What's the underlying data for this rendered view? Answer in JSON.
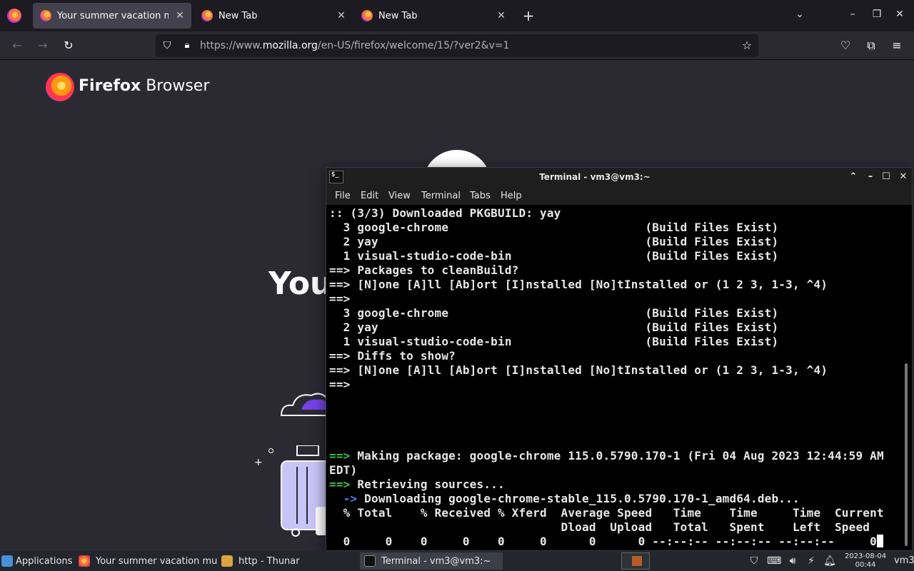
{
  "browser": {
    "tabs": [
      {
        "title": "Your summer vacation mus",
        "active": true
      },
      {
        "title": "New Tab",
        "active": false
      },
      {
        "title": "New Tab",
        "active": false
      }
    ],
    "new_tab_symbol": "+",
    "url_scheme": "https://www.",
    "url_host": "mozilla.org",
    "url_path": "/en-US/firefox/welcome/15/?ver2&v=1",
    "icons": [
      "back-icon",
      "forward-icon",
      "reload-icon",
      "shield-icon",
      "lock-icon",
      "star-icon",
      "pocket-icon",
      "extensions-icon",
      "menu-icon"
    ]
  },
  "page": {
    "brand_bold": "Firefox",
    "brand_light": " Browser",
    "hero_title_fragment": "You"
  },
  "terminal": {
    "title": "Terminal - vm3@vm3:~",
    "menu": [
      "File",
      "Edit",
      "View",
      "Terminal",
      "Tabs",
      "Help"
    ],
    "lines": [
      {
        "prefix": "",
        "text": ":: (3/3) Downloaded PKGBUILD: yay"
      },
      {
        "prefix": "",
        "text": "  3 google-chrome                            (Build Files Exist)"
      },
      {
        "prefix": "",
        "text": "  2 yay                                      (Build Files Exist)"
      },
      {
        "prefix": "",
        "text": "  1 visual-studio-code-bin                   (Build Files Exist)"
      },
      {
        "prefix": "==>",
        "text": " Packages to cleanBuild?"
      },
      {
        "prefix": "==>",
        "text": " [N]one [A]ll [Ab]ort [I]nstalled [No]tInstalled or (1 2 3, 1-3, ^4)"
      },
      {
        "prefix": "==>",
        "text": ""
      },
      {
        "prefix": "",
        "text": "  3 google-chrome                            (Build Files Exist)"
      },
      {
        "prefix": "",
        "text": "  2 yay                                      (Build Files Exist)"
      },
      {
        "prefix": "",
        "text": "  1 visual-studio-code-bin                   (Build Files Exist)"
      },
      {
        "prefix": "==>",
        "text": " Diffs to show?"
      },
      {
        "prefix": "==>",
        "text": " [N]one [A]ll [Ab]ort [I]nstalled [No]tInstalled or (1 2 3, 1-3, ^4)"
      },
      {
        "prefix": "==>",
        "text": ""
      },
      {
        "prefix": "",
        "text": ""
      },
      {
        "prefix": "",
        "text": ""
      },
      {
        "prefix": "",
        "text": ""
      },
      {
        "prefix": "",
        "text": ""
      },
      {
        "prefix": "==>",
        "text": " Making package: google-chrome 115.0.5790.170-1 (Fri 04 Aug 2023 12:44:59 AM",
        "green": true
      },
      {
        "prefix": "",
        "text": "EDT)"
      },
      {
        "prefix": "==>",
        "text": " Retrieving sources...",
        "green": true
      },
      {
        "prefix": "  ->",
        "text": " Downloading google-chrome-stable_115.0.5790.170-1_amd64.deb...",
        "blue": true
      },
      {
        "prefix": "",
        "text": "  % Total    % Received % Xferd  Average Speed   Time    Time     Time  Current"
      },
      {
        "prefix": "",
        "text": "                                 Dload  Upload   Total   Spent    Left  Speed"
      },
      {
        "prefix": "",
        "text": "  0     0    0     0    0     0      0      0 --:--:-- --:--:-- --:--:--     0"
      }
    ]
  },
  "taskbar": {
    "applications_label": "Applications",
    "tasks": [
      {
        "label": "Your summer vacation mu...",
        "active": false
      },
      {
        "label": "http - Thunar",
        "active": false
      },
      {
        "label": "Terminal - vm3@vm3:~",
        "active": true
      }
    ],
    "clock_date": "2023-08-04",
    "clock_time": "00:44",
    "user": "vm3"
  },
  "colors": {
    "green_prompt": "#34c44e",
    "blue_prompt": "#5b7bff",
    "tab_active": "#42414d"
  }
}
